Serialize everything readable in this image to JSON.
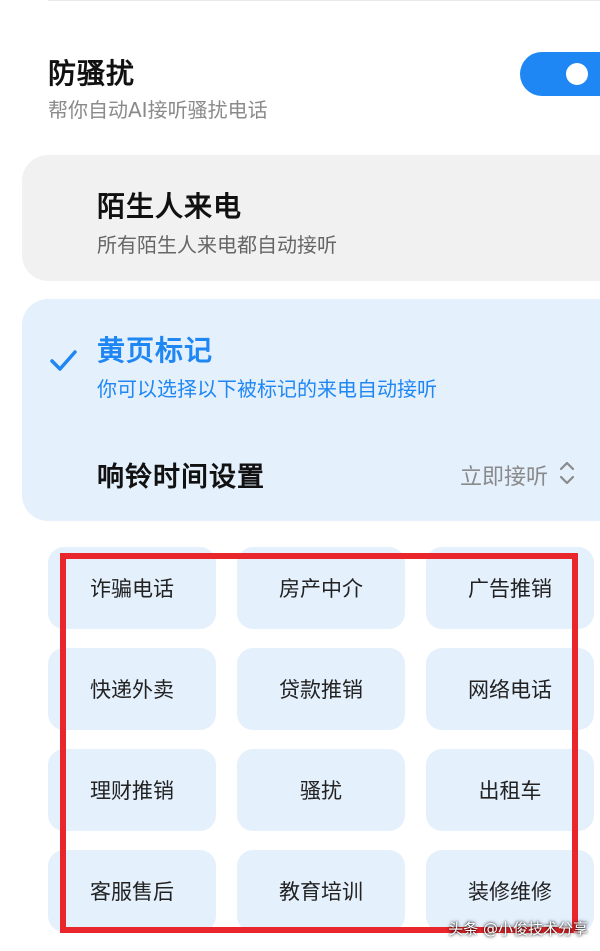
{
  "anti_harassment": {
    "title": "防骚扰",
    "subtitle": "帮你自动AI接听骚扰电话",
    "enabled": true
  },
  "options": {
    "stranger": {
      "title": "陌生人来电",
      "subtitle": "所有陌生人来电都自动接听",
      "selected": false
    },
    "yellow_pages": {
      "title": "黄页标记",
      "subtitle": "你可以选择以下被标记的来电自动接听",
      "selected": true
    }
  },
  "ring_setting": {
    "label": "响铃时间设置",
    "value": "立即接听"
  },
  "categories": [
    "诈骗电话",
    "房产中介",
    "广告推销",
    "快递外卖",
    "贷款推销",
    "网络电话",
    "理财推销",
    "骚扰",
    "出租车",
    "客服售后",
    "教育培训",
    "装修维修"
  ],
  "watermark": "头条 @小俊技术分享",
  "colors": {
    "accent": "#1f87f4",
    "selected_card_bg": "#e5f0fd",
    "unselected_card_bg": "#f1f1f1",
    "highlight_border": "#e8262b"
  },
  "icons": {
    "selected_mark": "checkmark-icon",
    "ring_value_indicator": "updown-chevron-icon"
  }
}
